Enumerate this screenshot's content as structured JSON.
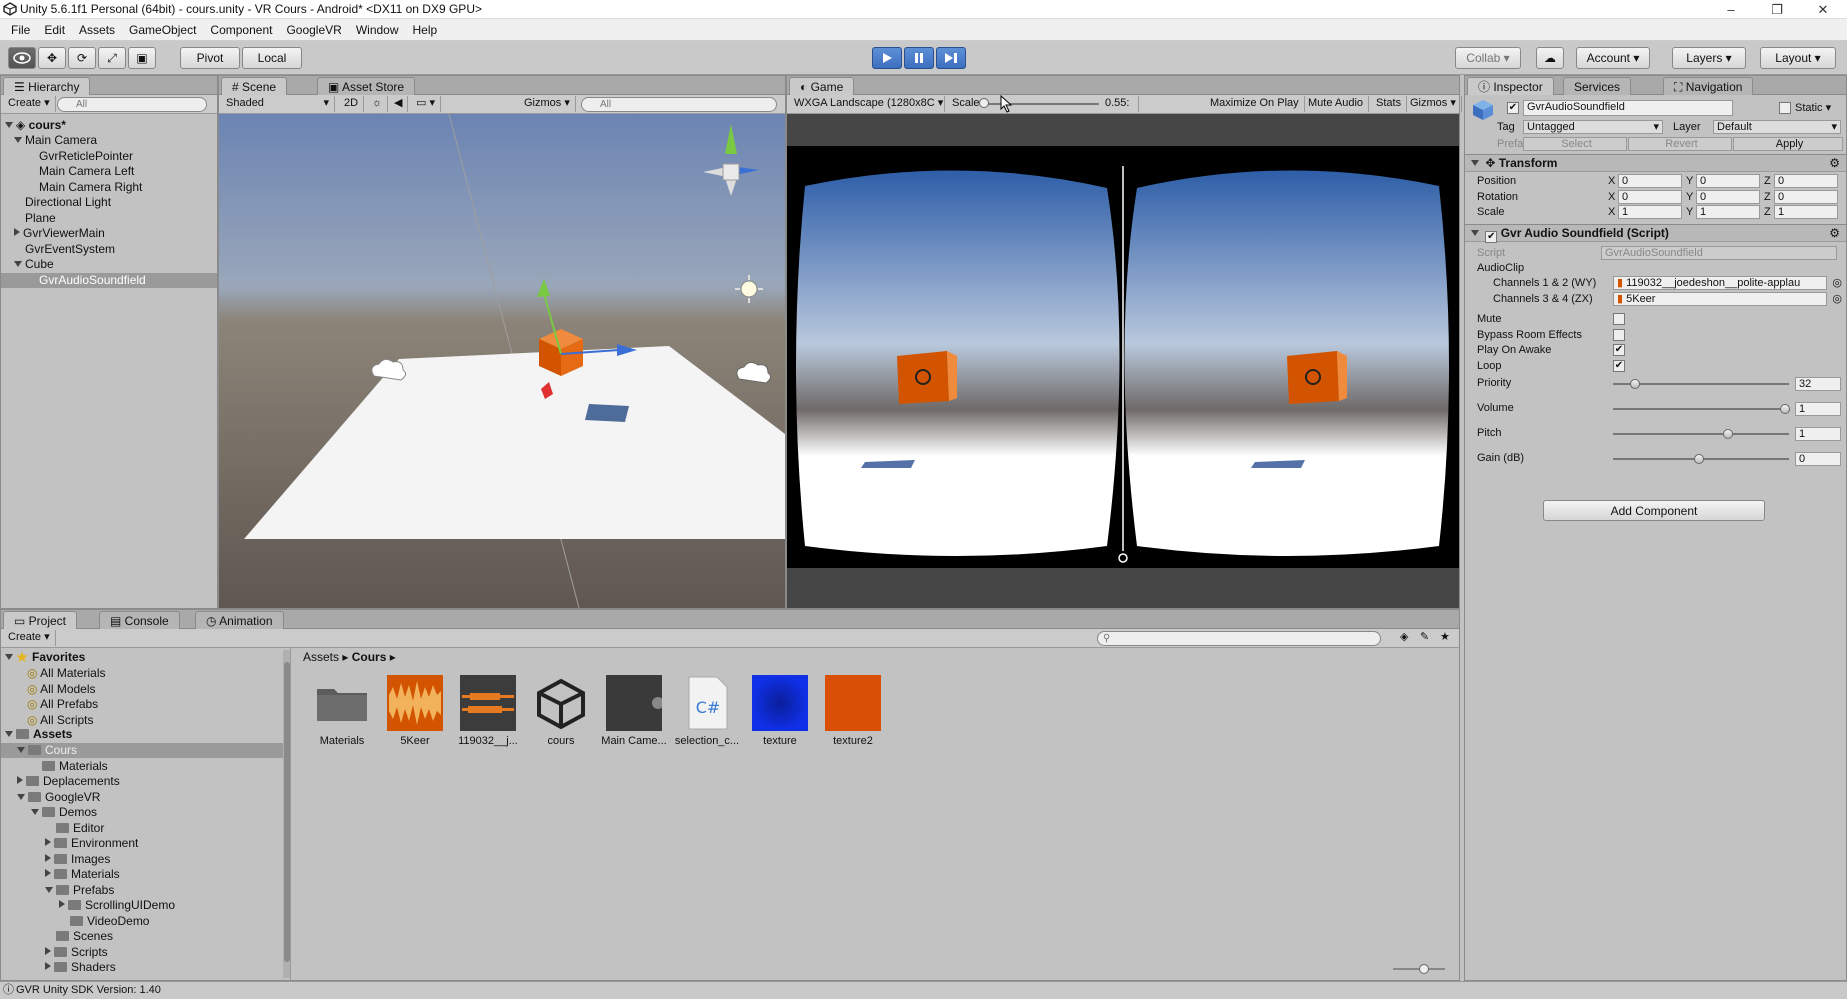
{
  "window": {
    "title": "Unity 5.6.1f1 Personal (64bit) - cours.unity - VR Cours - Android* <DX11 on DX9 GPU>",
    "minimize": "–",
    "maximize": "❐",
    "close": "✕"
  },
  "menu": [
    "File",
    "Edit",
    "Assets",
    "GameObject",
    "Component",
    "GoogleVR",
    "Window",
    "Help"
  ],
  "toolbar": {
    "pivot": "Pivot",
    "local": "Local",
    "collab": "Collab",
    "account": "Account",
    "layers": "Layers",
    "layout": "Layout"
  },
  "hierarchy": {
    "tab": "Hierarchy",
    "create": "Create",
    "search_placeholder": "All",
    "scene": "cours*",
    "items": [
      {
        "label": "Main Camera",
        "depth": 1,
        "expanded": true
      },
      {
        "label": "GvrReticlePointer",
        "depth": 2
      },
      {
        "label": "Main Camera Left",
        "depth": 2
      },
      {
        "label": "Main Camera Right",
        "depth": 2
      },
      {
        "label": "Directional Light",
        "depth": 1
      },
      {
        "label": "Plane",
        "depth": 1
      },
      {
        "label": "GvrViewerMain",
        "depth": 1,
        "collapsed": true
      },
      {
        "label": "GvrEventSystem",
        "depth": 1
      },
      {
        "label": "Cube",
        "depth": 1,
        "expanded": true
      },
      {
        "label": "GvrAudioSoundfield",
        "depth": 2,
        "selected": true
      }
    ]
  },
  "scene": {
    "tabs": [
      "Scene",
      "Asset Store"
    ],
    "shaded": "Shaded",
    "mode2d": "2D",
    "gizmos": "Gizmos",
    "search_placeholder": "All"
  },
  "game": {
    "tab": "Game",
    "resolution": "WXGA Landscape (1280x8C",
    "scale_label": "Scale",
    "scale_value": "0.55:",
    "maximize": "Maximize On Play",
    "mute": "Mute Audio",
    "stats": "Stats",
    "gizmos": "Gizmos"
  },
  "inspector": {
    "tabs": [
      "Inspector",
      "Services",
      "Navigation"
    ],
    "object_name": "GvrAudioSoundfield",
    "static": "Static",
    "tag_label": "Tag",
    "tag_value": "Untagged",
    "layer_label": "Layer",
    "layer_value": "Default",
    "prefab_label": "Prefab",
    "prefab_select": "Select",
    "prefab_revert": "Revert",
    "prefab_apply": "Apply",
    "transform": {
      "title": "Transform",
      "rows": [
        {
          "label": "Position",
          "x": "0",
          "y": "0",
          "z": "0"
        },
        {
          "label": "Rotation",
          "x": "0",
          "y": "0",
          "z": "0"
        },
        {
          "label": "Scale",
          "x": "1",
          "y": "1",
          "z": "1"
        }
      ]
    },
    "axis": {
      "x": "X",
      "y": "Y",
      "z": "Z"
    },
    "script_comp": {
      "title": "Gvr Audio Soundfield (Script)",
      "script_label": "Script",
      "script_value": "GvrAudioSoundfield",
      "audioclip_label": "AudioClip",
      "ch12_label": "Channels 1 & 2 (WY)",
      "ch12_value": "119032__joedeshon__polite-applau",
      "ch34_label": "Channels 3 & 4 (ZX)",
      "ch34_value": "5Keer",
      "toggles": [
        {
          "label": "Mute",
          "checked": false
        },
        {
          "label": "Bypass Room Effects",
          "checked": false
        },
        {
          "label": "Play On Awake",
          "checked": true
        },
        {
          "label": "Loop",
          "checked": true
        }
      ],
      "sliders": [
        {
          "label": "Priority",
          "value": "32",
          "fraction": 0.13
        },
        {
          "label": "Volume",
          "value": "1",
          "fraction": 1.0
        },
        {
          "label": "Pitch",
          "value": "1",
          "fraction": 0.67
        },
        {
          "label": "Gain (dB)",
          "value": "0",
          "fraction": 0.5
        }
      ],
      "check_mark": "✔"
    },
    "add_component": "Add Component"
  },
  "project": {
    "tabs": [
      "Project",
      "Console",
      "Animation"
    ],
    "create": "Create",
    "favorites": "Favorites",
    "fav_items": [
      "All Materials",
      "All Models",
      "All Prefabs",
      "All Scripts"
    ],
    "assets_root": "Assets",
    "tree": [
      {
        "label": "Cours",
        "depth": 1,
        "expanded": true,
        "selected": true
      },
      {
        "label": "Materials",
        "depth": 2
      },
      {
        "label": "Deplacements",
        "depth": 1,
        "collapsed": true
      },
      {
        "label": "GoogleVR",
        "depth": 1,
        "expanded": true
      },
      {
        "label": "Demos",
        "depth": 2,
        "expanded": true
      },
      {
        "label": "Editor",
        "depth": 3
      },
      {
        "label": "Environment",
        "depth": 3,
        "collapsed": true
      },
      {
        "label": "Images",
        "depth": 3,
        "collapsed": true
      },
      {
        "label": "Materials",
        "depth": 3,
        "collapsed": true
      },
      {
        "label": "Prefabs",
        "depth": 3,
        "expanded": true
      },
      {
        "label": "ScrollingUIDemo",
        "depth": 4,
        "collapsed": true
      },
      {
        "label": "VideoDemo",
        "depth": 4
      },
      {
        "label": "Scenes",
        "depth": 3
      },
      {
        "label": "Scripts",
        "depth": 3,
        "collapsed": true
      },
      {
        "label": "Shaders",
        "depth": 3,
        "collapsed": true
      }
    ],
    "breadcrumb": [
      "Assets",
      "Cours"
    ],
    "assets": [
      {
        "label": "Materials",
        "kind": "folder"
      },
      {
        "label": "5Keer",
        "kind": "audio"
      },
      {
        "label": "119032__j...",
        "kind": "audio-dark"
      },
      {
        "label": "cours",
        "kind": "unity"
      },
      {
        "label": "Main Came...",
        "kind": "prefab"
      },
      {
        "label": "selection_c...",
        "kind": "script"
      },
      {
        "label": "texture",
        "kind": "blue"
      },
      {
        "label": "texture2",
        "kind": "orange"
      }
    ],
    "script_glyph": "C#"
  },
  "status": "GVR Unity SDK Version: 1.40",
  "colors": {
    "accent": "#3d6fc0",
    "selection": "#3e7ad3",
    "orange": "#d35400",
    "blue": "#0a2bd6"
  }
}
